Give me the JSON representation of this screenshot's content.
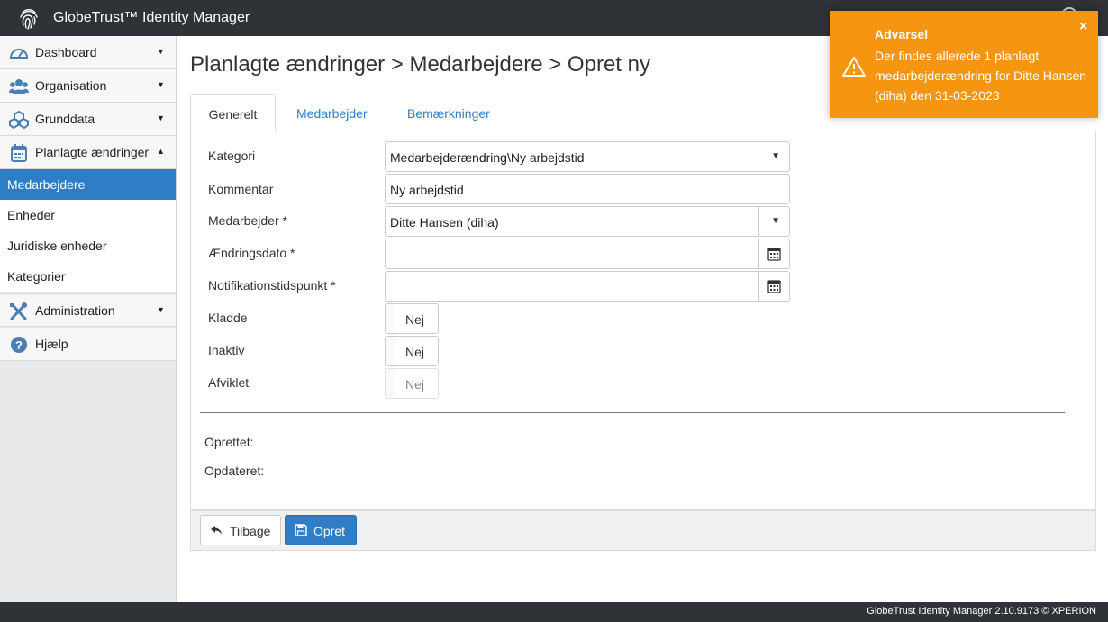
{
  "app": {
    "title": "GlobeTrust™ Identity Manager"
  },
  "sidebar": {
    "groups": [
      {
        "label": "Dashboard",
        "icon": "dashboard-gauge-icon",
        "caret": "▼"
      },
      {
        "label": "Organisation",
        "icon": "users-icon",
        "caret": "▼"
      },
      {
        "label": "Grunddata",
        "icon": "cubes-icon",
        "caret": "▼"
      },
      {
        "label": "Planlagte ændringer",
        "icon": "calendar-icon",
        "caret": "▲"
      },
      {
        "label": "Administration",
        "icon": "tools-icon",
        "caret": "▼"
      },
      {
        "label": "Hjælp",
        "icon": "help-icon"
      }
    ],
    "subitems": [
      {
        "label": "Medarbejdere",
        "active": true
      },
      {
        "label": "Enheder"
      },
      {
        "label": "Juridiske enheder"
      },
      {
        "label": "Kategorier"
      }
    ]
  },
  "page": {
    "title": "Planlagte ændringer > Medarbejdere > Opret ny",
    "tabs": [
      {
        "label": "Generelt",
        "active": true
      },
      {
        "label": "Medarbejder"
      },
      {
        "label": "Bemærkninger"
      }
    ]
  },
  "form": {
    "kategori": {
      "label": "Kategori",
      "value": "Medarbejderændring\\Ny arbejdstid"
    },
    "kommentar": {
      "label": "Kommentar",
      "value": "Ny arbejdstid"
    },
    "medarbejder": {
      "label": "Medarbejder *",
      "value": "Ditte Hansen (diha)"
    },
    "aendringsdato": {
      "label": "Ændringsdato *",
      "value": ""
    },
    "notifikation": {
      "label": "Notifikationstidspunkt *",
      "value": ""
    },
    "kladde": {
      "label": "Kladde",
      "value": "Nej"
    },
    "inaktiv": {
      "label": "Inaktiv",
      "value": "Nej"
    },
    "afviklet": {
      "label": "Afviklet",
      "value": "Nej"
    },
    "oprettet": "Oprettet:",
    "opdateret": "Opdateret:"
  },
  "actions": {
    "back": "Tilbage",
    "create": "Opret"
  },
  "footer": {
    "copyright": "GlobeTrust Identity Manager 2.10.9173 © XPERION"
  },
  "toast": {
    "title": "Advarsel",
    "message": "Der findes allerede 1 planlagt medarbejderændring for Ditte Hansen (diha) den 31-03-2023",
    "close": "×"
  },
  "colors": {
    "primary": "#2f7dc4",
    "topbar": "#2f3237",
    "warning": "#f6950f"
  }
}
